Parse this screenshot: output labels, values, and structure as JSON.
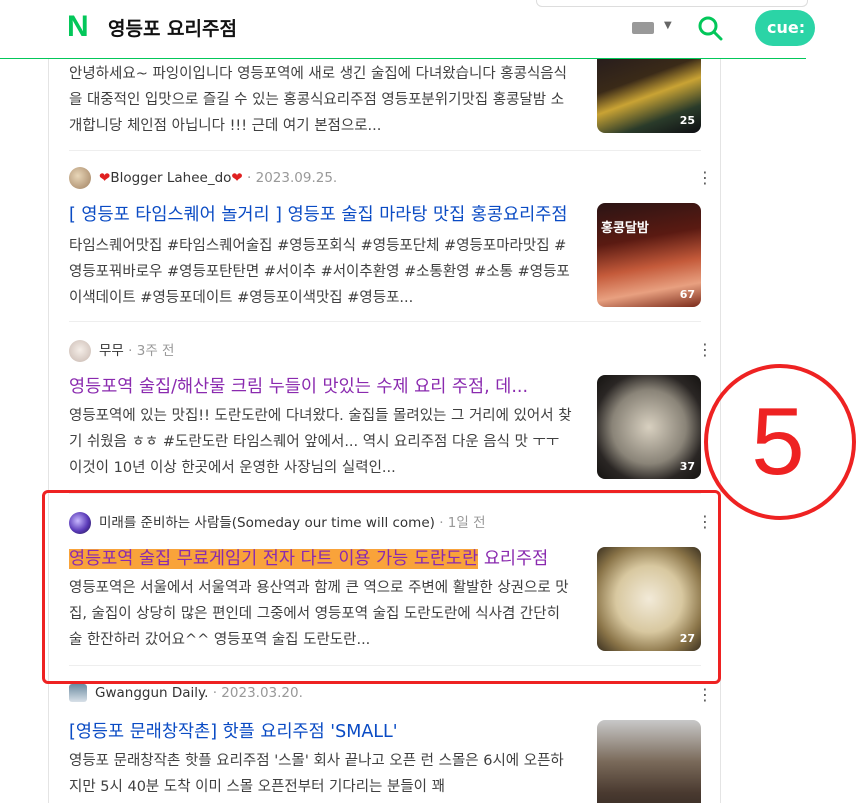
{
  "header": {
    "query": "영등포 요리주점",
    "cue_label": "cue:"
  },
  "items": [
    {
      "desc": "안녕하세요~ 파잉이입니다 영등포역에 새로 생긴 술집에 다녀왔습니다 홍콩식음식을 대중적인 입맛으로 즐길 수 있는 홍콩식요리주점 영등포분위기맛집 홍콩달밤 소개합니당 체인점 아닙니다 !!! 근데 여기 본점으로...",
      "count": "25"
    },
    {
      "author": "Blogger Lahee_do",
      "date": "2023.09.25.",
      "title": "[ 영등포 타임스퀘어 놀거리 ] 영등포 술집 마라탕 맛집 홍콩요리주점",
      "desc": "타임스퀘어맛집 #타임스퀘어술집 #영등포회식 #영등포단체 #영등포마라맛집 #영등포꿔바로우 #영등포탄탄면 #서이추 #서이추환영 #소통환영 #소통 #영등포이색데이트 #영등포데이트 #영등포이색맛집 #영등포...",
      "count": "67",
      "thumb_text": "홍콩달밤"
    },
    {
      "author": "무무",
      "date": "3주 전",
      "title": "영등포역 술집/해산물 크림 누들이 맛있는 수제 요리 주점, 데...",
      "desc": "영등포역에 있는 맛집!! 도란도란에 다녀왔다. 술집들 몰려있는 그 거리에 있어서 찾기 쉬웠음 ㅎㅎ #도란도란 타임스퀘어 앞에서... 역시 요리주점 다운 음식 맛 ㅜㅜ 이것이 10년 이상 한곳에서 운영한 사장님의 실력인...",
      "count": "37"
    },
    {
      "author": "미래를 준비하는 사람들(Someday our time will come)",
      "date": "1일 전",
      "title_hl": "영등포역 술집 무료게임기 전자 다트 이용 가능 도란도란",
      "title_rest": " 요리주점",
      "desc": "영등포역은 서울에서 서울역과 용산역과 함께 큰 역으로 주변에 활발한 상권으로 맛집, 술집이 상당히 많은 편인데 그중에서 영등포역 술집 도란도란에 식사겸 간단히 술 한잔하러 갔어요^^ 영등포역 술집 도란도란...",
      "count": "27"
    },
    {
      "author": "Gwanggun Daily.",
      "date": "2023.03.20.",
      "title": "[영등포 문래창작촌] 핫플 요리주점 'SMALL'",
      "desc": "영등포 문래창작촌 핫플 요리주점 '스몰' 회사 끝나고 오픈 런 스몰은 6시에 오픈하지만 5시 40분 도착 이미 스몰 오픈전부터 기다리는 분들이 꽤"
    }
  ],
  "annotation": {
    "number": "5",
    "color": "#e22222"
  }
}
